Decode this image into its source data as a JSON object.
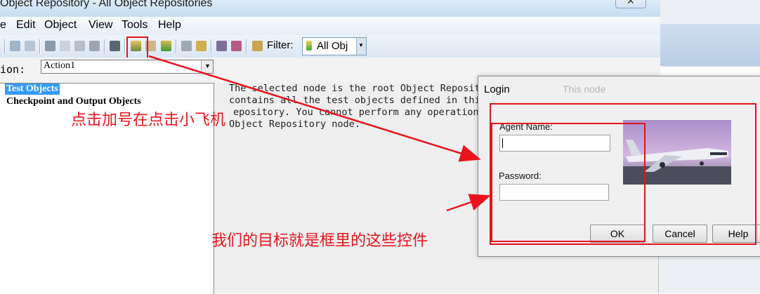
{
  "window": {
    "title": "Object Repository - All Object Repositories",
    "close_glyph": "✕"
  },
  "menu": {
    "items": [
      {
        "label": "e"
      },
      {
        "label": "Edit"
      },
      {
        "label": "Object"
      },
      {
        "label": "View"
      },
      {
        "label": "Tools"
      },
      {
        "label": "Help"
      }
    ]
  },
  "toolbar": {
    "filter_label": "Filter:",
    "filter_value": "All Obj"
  },
  "action": {
    "label": "ion:",
    "value": "Action1"
  },
  "tree": {
    "items": [
      {
        "label": "Test Objects"
      },
      {
        "label": "Checkpoint and Output Objects"
      }
    ]
  },
  "description": {
    "lines": [
      "The selected node is the root Object Repositor",
      "contains all the test objects defined in this",
      "epository. You cannot perform any operations",
      "Object Repository node."
    ]
  },
  "dialog": {
    "title": "Login",
    "ghost_text": "This node",
    "agent_name_label": "Agent Name:",
    "agent_name_value": "",
    "password_label": "Password:",
    "password_value": "",
    "ok_label": "OK",
    "cancel_label": "Cancel",
    "help_label": "Help"
  },
  "annotations": {
    "click_hint": "点击加号在点击小飞机",
    "target_hint": "我们的目标就是框里的这些控件",
    "accent_color": "#e8141c"
  }
}
